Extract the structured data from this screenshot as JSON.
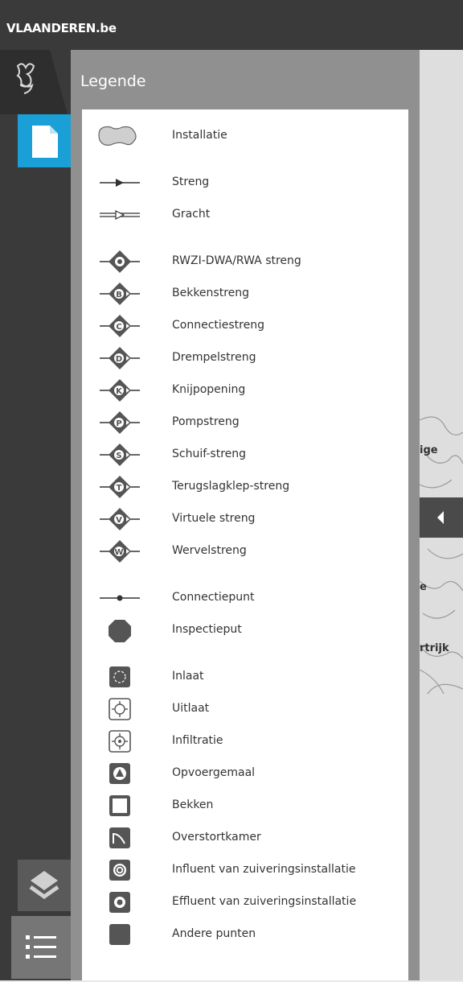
{
  "header": {
    "brand": "VLAANDEREN.be"
  },
  "sidebar": {
    "tabs": [
      {
        "name": "logo",
        "icon": "flanders-lion-logo"
      },
      {
        "name": "document",
        "icon": "document-icon",
        "active": true
      },
      {
        "name": "layers",
        "icon": "layers-icon"
      },
      {
        "name": "legend",
        "icon": "list-icon"
      }
    ]
  },
  "panel": {
    "title": "Legende"
  },
  "map": {
    "labels": [
      "ige",
      "e",
      "rtrijk"
    ]
  },
  "legend": {
    "items": [
      {
        "label": "Installatie",
        "icon": "area-polygon-icon"
      },
      {
        "label": "Streng",
        "icon": "arrow-line-icon"
      },
      {
        "label": "Gracht",
        "icon": "double-arrow-line-icon"
      },
      {
        "label": "RWZI-DWA/RWA streng",
        "icon": "diamond-ring-icon"
      },
      {
        "label": "Bekkenstreng",
        "icon": "diamond-letter-icon",
        "letter": "B"
      },
      {
        "label": "Connectiestreng",
        "icon": "diamond-letter-icon",
        "letter": "C"
      },
      {
        "label": "Drempelstreng",
        "icon": "diamond-letter-icon",
        "letter": "D"
      },
      {
        "label": "Knijpopening",
        "icon": "diamond-letter-icon",
        "letter": "K"
      },
      {
        "label": "Pompstreng",
        "icon": "diamond-letter-icon",
        "letter": "P"
      },
      {
        "label": "Schuif-streng",
        "icon": "diamond-letter-icon",
        "letter": "S"
      },
      {
        "label": "Terugslagklep-streng",
        "icon": "diamond-letter-icon",
        "letter": "T"
      },
      {
        "label": "Virtuele streng",
        "icon": "diamond-letter-icon",
        "letter": "V"
      },
      {
        "label": "Wervelstreng",
        "icon": "diamond-letter-icon",
        "letter": "W"
      },
      {
        "label": "Connectiepunt",
        "icon": "dot-line-icon"
      },
      {
        "label": "Inspectieput",
        "icon": "octagon-icon"
      },
      {
        "label": "Inlaat",
        "icon": "inlet-icon"
      },
      {
        "label": "Uitlaat",
        "icon": "outlet-icon"
      },
      {
        "label": "Infiltratie",
        "icon": "infiltration-icon"
      },
      {
        "label": "Opvoergemaal",
        "icon": "pump-icon"
      },
      {
        "label": "Bekken",
        "icon": "basin-icon"
      },
      {
        "label": "Overstortkamer",
        "icon": "overflow-icon"
      },
      {
        "label": "Influent van zuiveringsinstallatie",
        "icon": "influent-icon"
      },
      {
        "label": "Effluent van zuiveringsinstallatie",
        "icon": "effluent-icon"
      },
      {
        "label": "Andere punten",
        "icon": "other-points-icon"
      }
    ]
  },
  "colors": {
    "accent": "#1aa0d6",
    "symbol": "#555555",
    "bar": "#3a3a3a",
    "panel": "#909090"
  }
}
